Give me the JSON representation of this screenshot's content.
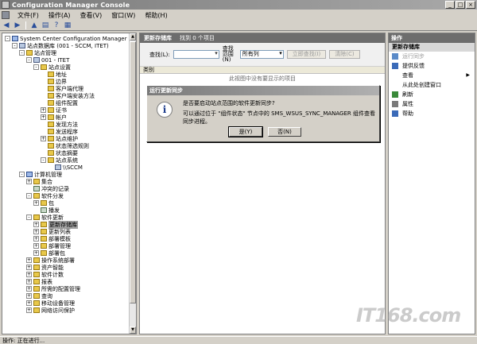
{
  "window": {
    "title": "Configuration Manager Console",
    "controls": [
      "_",
      "□",
      "×"
    ]
  },
  "menu": [
    "文件(F)",
    "操作(A)",
    "查看(V)",
    "窗口(W)",
    "帮助(H)"
  ],
  "toolbar": {
    "buttons": [
      "back-icon",
      "forward-icon",
      "up-folder-icon",
      "show-tree-icon",
      "help-icon",
      "refresh-icon"
    ]
  },
  "tree": {
    "items": [
      {
        "label": "System Center Configuration Manager",
        "level": 0,
        "expander": "-",
        "icon": "monitor"
      },
      {
        "label": "站点数据库 (001 - SCCM, ITET)",
        "level": 1,
        "expander": "-",
        "icon": "server"
      },
      {
        "label": "站点管理",
        "level": 2,
        "expander": "-",
        "icon": "folder"
      },
      {
        "label": "001 - ITET",
        "level": 3,
        "expander": "-",
        "icon": "server"
      },
      {
        "label": "站点设置",
        "level": 4,
        "expander": "-",
        "icon": "folder"
      },
      {
        "label": "地址",
        "level": 5,
        "expander": "",
        "icon": "folder"
      },
      {
        "label": "边界",
        "level": 5,
        "expander": "",
        "icon": "folder"
      },
      {
        "label": "客户端代理",
        "level": 5,
        "expander": "",
        "icon": "folder"
      },
      {
        "label": "客户端安装方法",
        "level": 5,
        "expander": "",
        "icon": "folder"
      },
      {
        "label": "组件配置",
        "level": 5,
        "expander": "",
        "icon": "folder"
      },
      {
        "label": "证书",
        "level": 5,
        "expander": "+",
        "icon": "folder"
      },
      {
        "label": "帐户",
        "level": 5,
        "expander": "+",
        "icon": "folder"
      },
      {
        "label": "发现方法",
        "level": 5,
        "expander": "",
        "icon": "folder"
      },
      {
        "label": "发送程序",
        "level": 5,
        "expander": "",
        "icon": "folder"
      },
      {
        "label": "站点维护",
        "level": 5,
        "expander": "+",
        "icon": "folder"
      },
      {
        "label": "状态筛选规则",
        "level": 5,
        "expander": "",
        "icon": "folder"
      },
      {
        "label": "状态摘要",
        "level": 5,
        "expander": "",
        "icon": "folder"
      },
      {
        "label": "站点系统",
        "level": 5,
        "expander": "-",
        "icon": "folder"
      },
      {
        "label": "\\\\SCCM",
        "level": 6,
        "expander": "",
        "icon": "server"
      },
      {
        "label": "计算机管理",
        "level": 2,
        "expander": "-",
        "icon": "monitor"
      },
      {
        "label": "集合",
        "level": 3,
        "expander": "+",
        "icon": "folder"
      },
      {
        "label": "冲突的记录",
        "level": 3,
        "expander": "",
        "icon": "item"
      },
      {
        "label": "软件分发",
        "level": 3,
        "expander": "-",
        "icon": "folder"
      },
      {
        "label": "包",
        "level": 4,
        "expander": "+",
        "icon": "folder"
      },
      {
        "label": "播发",
        "level": 4,
        "expander": "",
        "icon": "item"
      },
      {
        "label": "软件更新",
        "level": 3,
        "expander": "-",
        "icon": "folder"
      },
      {
        "label": "更新存储库",
        "level": 4,
        "expander": "+",
        "icon": "folder",
        "selected": true
      },
      {
        "label": "更新列表",
        "level": 4,
        "expander": "+",
        "icon": "folder"
      },
      {
        "label": "部署模板",
        "level": 4,
        "expander": "+",
        "icon": "folder"
      },
      {
        "label": "部署管理",
        "level": 4,
        "expander": "+",
        "icon": "folder"
      },
      {
        "label": "部署包",
        "level": 4,
        "expander": "+",
        "icon": "folder"
      },
      {
        "label": "操作系统部署",
        "level": 3,
        "expander": "+",
        "icon": "folder"
      },
      {
        "label": "资产智能",
        "level": 3,
        "expander": "+",
        "icon": "folder"
      },
      {
        "label": "软件计数",
        "level": 3,
        "expander": "+",
        "icon": "folder"
      },
      {
        "label": "报表",
        "level": 3,
        "expander": "+",
        "icon": "folder"
      },
      {
        "label": "所需的配置管理",
        "level": 3,
        "expander": "+",
        "icon": "folder"
      },
      {
        "label": "查询",
        "level": 3,
        "expander": "+",
        "icon": "folder"
      },
      {
        "label": "移动设备管理",
        "level": 3,
        "expander": "+",
        "icon": "folder"
      },
      {
        "label": "网络访问保护",
        "level": 3,
        "expander": "+",
        "icon": "folder"
      }
    ]
  },
  "center": {
    "title": "更新存储库",
    "item_count": "找到 0 个项目",
    "search_label": "查找(L):",
    "search_value": "",
    "scope_label": "查找范围(N)",
    "scope_value": "所有列",
    "find_now": "立即查找(I)",
    "clear": "清除(C)",
    "column": "类别",
    "empty_text": "此视图中没有要显示的项目"
  },
  "actions": {
    "header": "操作",
    "section": "更新存储库",
    "items": [
      {
        "label": "运行同步",
        "icon": "sync-icon",
        "disabled": true,
        "color": "#5a8ac8"
      },
      {
        "label": "提供反馈",
        "icon": "feedback-icon",
        "disabled": false,
        "color": "#3a6ab8"
      },
      {
        "label": "查看",
        "icon": "",
        "disabled": false,
        "submenu": true
      },
      {
        "label": "从此处创建窗口",
        "icon": "",
        "disabled": false
      },
      {
        "label": "刷新",
        "icon": "refresh-icon",
        "disabled": false,
        "color": "#3a8a3a"
      },
      {
        "label": "属性",
        "icon": "properties-icon",
        "disabled": false,
        "color": "#7a7a7a"
      },
      {
        "label": "帮助",
        "icon": "help-icon",
        "disabled": false,
        "color": "#3a6ab8"
      }
    ]
  },
  "dialog": {
    "title": "运行更新同步",
    "icon": "info-icon",
    "line1": "是否要启动站点范围的软件更新同步?",
    "line2": "可以通过位于 \"组件状态\" 节点中的 SMS_WSUS_SYNC_MANAGER 组件查看同步进程。",
    "yes": "是(Y)",
    "no": "否(N)"
  },
  "status": "操作: 正在进行...",
  "watermark": "IT168.com"
}
